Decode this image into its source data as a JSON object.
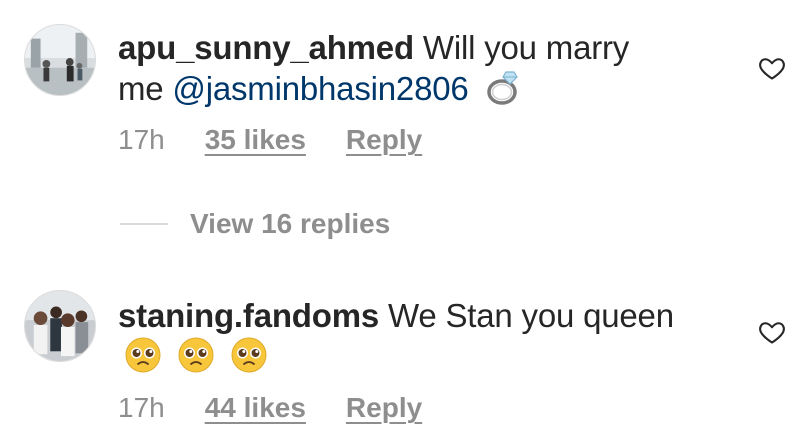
{
  "comments": [
    {
      "username": "apu_sunny_ahmed",
      "text_before": "Will you marry me",
      "mention": "@jasminbhasin2806",
      "emoji": "ring-emoji",
      "time": "17h",
      "likes": "35 likes",
      "reply_label": "Reply"
    },
    {
      "username": "staning.fandoms",
      "text_before": "We Stan you queen",
      "emoji": "pleading-face-emoji",
      "time": "17h",
      "likes": "44 likes",
      "reply_label": "Reply"
    }
  ],
  "view_replies_label": "View 16 replies",
  "colors": {
    "text": "#262626",
    "muted": "#8e8e8e",
    "mention": "#00376b",
    "border": "#dbdbdb"
  }
}
